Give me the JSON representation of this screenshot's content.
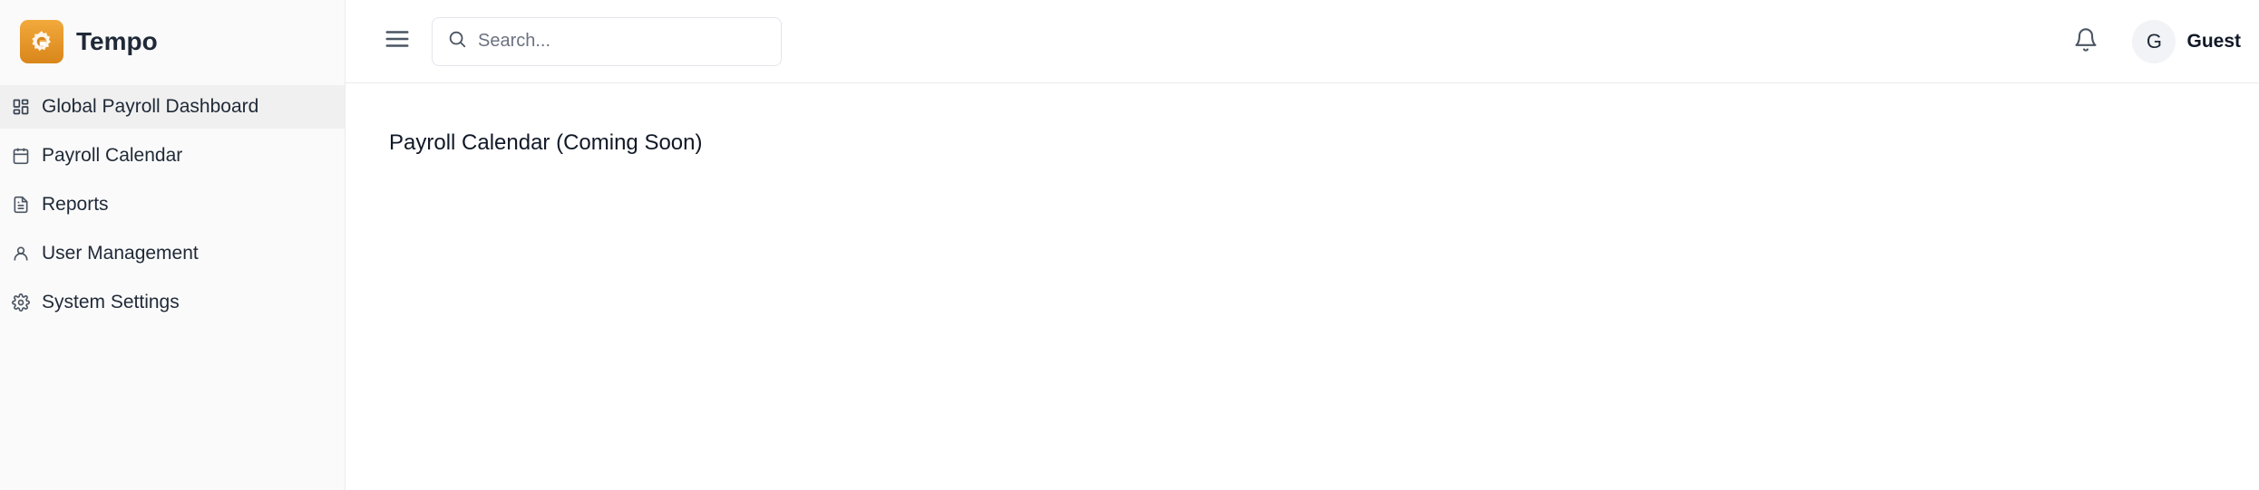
{
  "brand": {
    "name": "Tempo"
  },
  "sidebar": {
    "items": [
      {
        "label": "Global Payroll Dashboard",
        "icon": "dashboard-grid-icon",
        "active": true
      },
      {
        "label": "Payroll Calendar",
        "icon": "calendar-icon",
        "active": false
      },
      {
        "label": "Reports",
        "icon": "document-icon",
        "active": false
      },
      {
        "label": "User Management",
        "icon": "user-icon",
        "active": false
      },
      {
        "label": "System Settings",
        "icon": "gear-icon",
        "active": false
      }
    ]
  },
  "header": {
    "search_placeholder": "Search...",
    "user": {
      "initial": "G",
      "name": "Guest"
    }
  },
  "main": {
    "title": "Payroll Calendar (Coming Soon)"
  },
  "colors": {
    "brand_accent": "#e6951f",
    "icon": "#4b5563",
    "sidebar_bg": "#fafafa",
    "active_bg": "#f0f0f0"
  }
}
